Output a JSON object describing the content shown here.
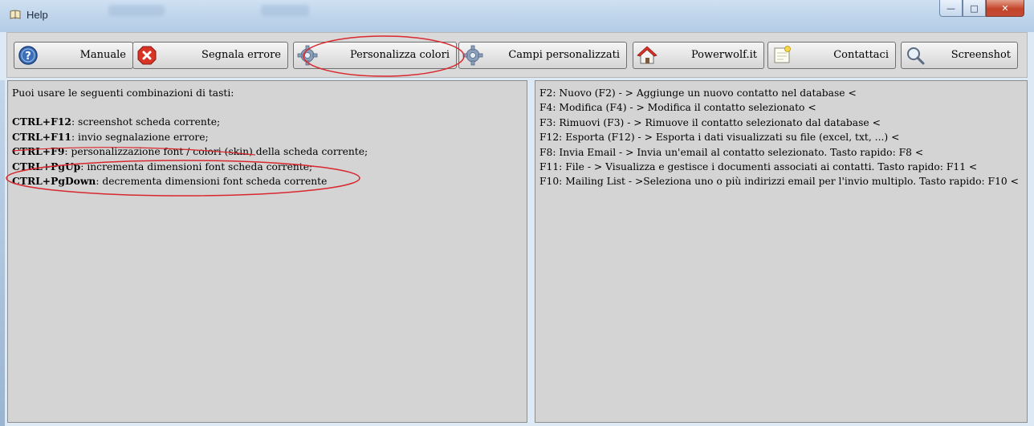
{
  "window": {
    "title": "Help",
    "controls": [
      "minimize",
      "maximize",
      "close"
    ]
  },
  "toolbar": {
    "buttons": [
      {
        "label": "Manuale",
        "icon": "help-circle-icon"
      },
      {
        "label": "Segnala errore",
        "icon": "error-x-icon"
      },
      {
        "label": "Personalizza colori",
        "icon": "gear-icon"
      },
      {
        "label": "Campi personalizzati",
        "icon": "gear-icon"
      },
      {
        "label": "Powerwolf.it",
        "icon": "home-icon"
      },
      {
        "label": "Contattaci",
        "icon": "note-icon"
      },
      {
        "label": "Screenshot",
        "icon": "magnifier-icon"
      }
    ]
  },
  "left_panel": {
    "intro": "Puoi usare le seguenti combinazioni di tasti:",
    "shortcuts": [
      {
        "key": "CTRL+F12",
        "desc": ": screenshot scheda corrente;"
      },
      {
        "key": "CTRL+F11",
        "desc": ": invio segnalazione errore;"
      },
      {
        "key": "CTRL+F9",
        "desc": ": personalizzazione font / colori (skin) della scheda corrente;"
      },
      {
        "key": "CTRL+PgUp",
        "desc": ": incrementa dimensioni font scheda corrente;"
      },
      {
        "key": "CTRL+PgDown",
        "desc": ": decrementa dimensioni font scheda corrente"
      }
    ]
  },
  "right_panel": {
    "lines": [
      "F2: Nuovo (F2)  - > Aggiunge un nuovo contatto nel database <",
      "F4: Modifica (F4)  - > Modifica il contatto selezionato <",
      "F3: Rimuovi (F3)  - > Rimuove il contatto selezionato dal database <",
      "F12: Esporta  (F12)  - > Esporta i dati visualizzati su file (excel, txt, ...) <",
      "F8: Invia Email   - > Invia un'email al contatto selezionato. Tasto rapido: F8 <",
      "F11: File  - > Visualizza e gestisce i documenti associati ai contatti. Tasto rapido: F11 <",
      "F10: Mailing List  - >Seleziona uno o più indirizzi email per l'invio multiplo. Tasto rapido: F10 <"
    ]
  },
  "colors": {
    "annotation": "#d9272e",
    "panel_bg": "#d4d4d4",
    "toolbar_bg": "#d9d9d9",
    "titlebar": "#c4d8ee"
  }
}
